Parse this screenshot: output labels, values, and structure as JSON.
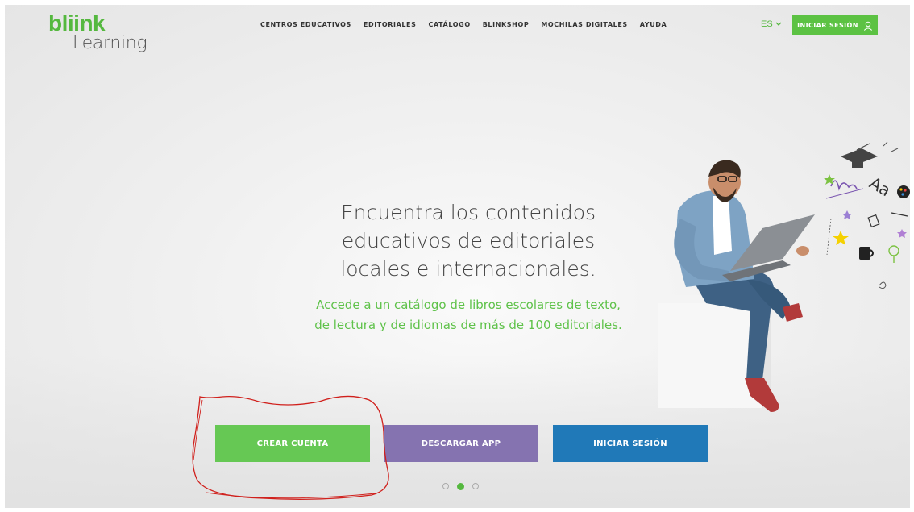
{
  "logo": {
    "top": "bliink",
    "bottom": "Learning"
  },
  "nav": {
    "items": [
      "CENTROS EDUCATIVOS",
      "EDITORIALES",
      "CATÁLOGO",
      "BLINKSHOP",
      "MOCHILAS DIGITALES",
      "AYUDA"
    ]
  },
  "lang": {
    "label": "ES",
    "icon": "chevron-down-icon"
  },
  "header_login": {
    "label": "INICIAR SESIÓN",
    "icon": "user-icon"
  },
  "hero": {
    "title_lines": [
      "Encuentra los contenidos",
      "educativos de editoriales",
      "locales e internacionales."
    ],
    "subtitle_lines": [
      "Accede a un catálogo de libros escolares de texto,",
      "de lectura y de idiomas de más de 100 editoriales."
    ]
  },
  "buttons": {
    "create_account": "CREAR CUENTA",
    "download_app": "DESCARGAR APP",
    "login": "INICIAR SESIÓN"
  },
  "carousel": {
    "dots": 3,
    "active_index": 1
  },
  "colors": {
    "brand_green": "#55b83f",
    "button_green": "#66c854",
    "button_purple": "#8573b0",
    "button_blue": "#2079b8",
    "annotation_red": "#d0201c"
  }
}
